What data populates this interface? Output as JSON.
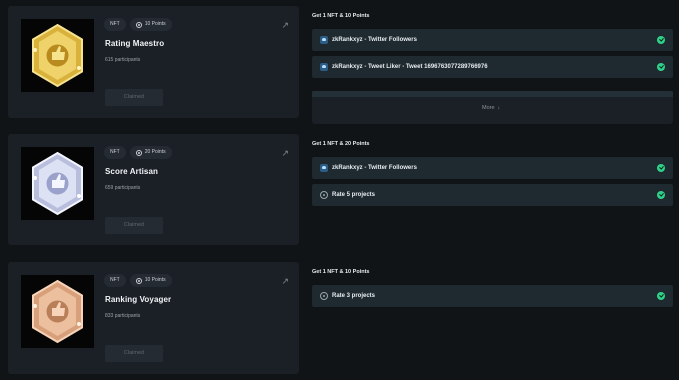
{
  "cards": [
    {
      "title": "Rating Maestro",
      "nft_chip": "NFT",
      "points_chip": "10 Points",
      "participants": "615 participants",
      "claim_label": "Claimed",
      "badge_color": "#e2bf4a",
      "reward_heading": "Get 1 NFT & 10 Points",
      "tasks": [
        {
          "label": "zkRankxyz - Twitter Followers",
          "icon": "twitter-icon"
        },
        {
          "label": "zkRankxyz - Tweet Liker - Tweet 1696763077289766976",
          "icon": "twitter-icon"
        }
      ],
      "more_label": "More"
    },
    {
      "title": "Score Artisan",
      "nft_chip": "NFT",
      "points_chip": "20 Points",
      "participants": "659 participants",
      "claim_label": "Claimed",
      "badge_color": "#c8cde8",
      "reward_heading": "Get 1 NFT & 20 Points",
      "tasks": [
        {
          "label": "zkRankxyz - Twitter Followers",
          "icon": "twitter-icon"
        },
        {
          "label": "Rate 5 projects",
          "icon": "rate-icon"
        }
      ]
    },
    {
      "title": "Ranking Voyager",
      "nft_chip": "NFT",
      "points_chip": "10 Points",
      "participants": "833 participants",
      "claim_label": "Claimed",
      "badge_color": "#e3b08a",
      "reward_heading": "Get 1 NFT & 10 Points",
      "tasks": [
        {
          "label": "Rate 3 projects",
          "icon": "rate-icon"
        }
      ]
    }
  ],
  "colors": {
    "background": "#111417",
    "card": "#1b2026",
    "task": "#1e2a30",
    "check": "#2fd08a"
  }
}
